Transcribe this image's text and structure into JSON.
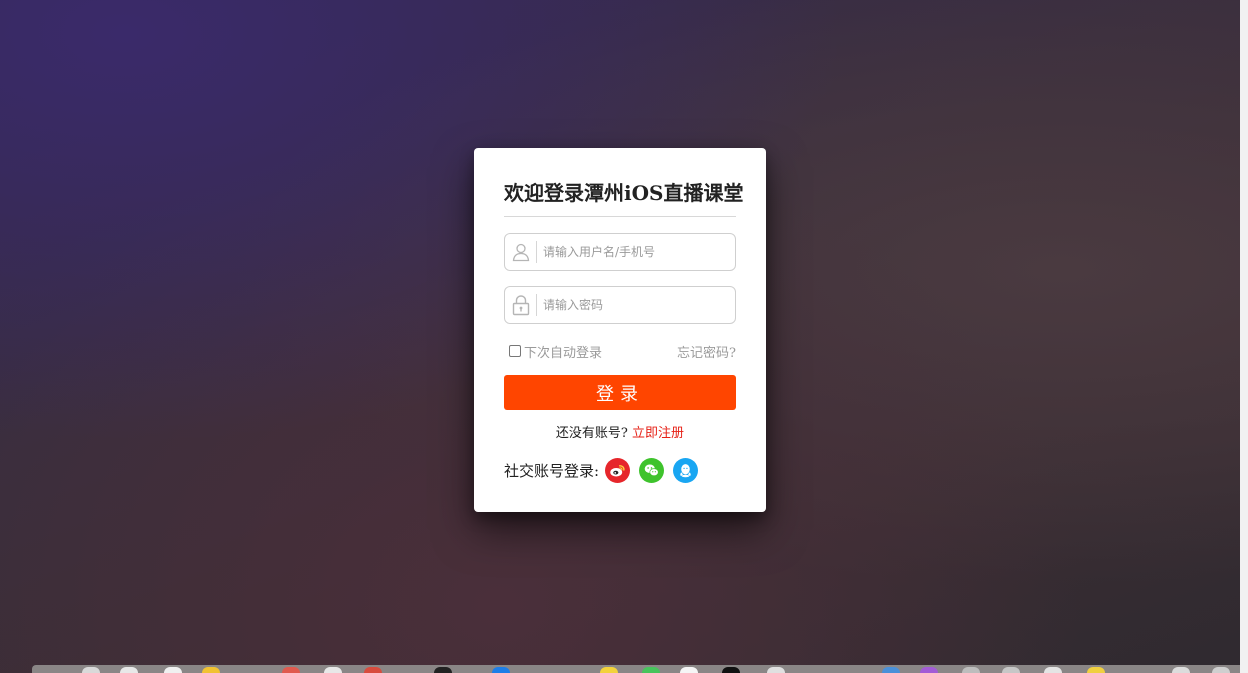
{
  "login": {
    "title": "欢迎登录潭州iOS直播课堂",
    "username_placeholder": "请输入用户名/手机号",
    "password_placeholder": "请输入密码",
    "remember_label": "下次自动登录",
    "forgot_label": "忘记密码?",
    "submit_label": "登录",
    "register_prompt": "还没有账号?",
    "register_link": "立即注册",
    "social_label": "社交账号登录:",
    "social_icons": [
      "weibo-icon",
      "wechat-icon",
      "qq-icon"
    ]
  },
  "colors": {
    "accent": "#ff4500",
    "link": "#e62117",
    "weibo": "#e6262b",
    "wechat": "#3ec32c",
    "qq": "#19a6f2"
  }
}
